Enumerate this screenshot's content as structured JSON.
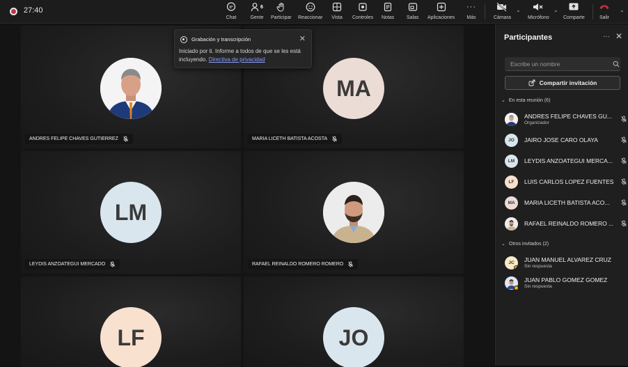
{
  "topbar": {
    "timer": "27:40",
    "people_count": "6",
    "items": [
      {
        "label": "Chat",
        "icon": "chat-icon"
      },
      {
        "label": "Gente",
        "icon": "people-icon"
      },
      {
        "label": "Participar",
        "icon": "raise-hand-icon"
      },
      {
        "label": "Reaccionar",
        "icon": "reaction-icon"
      },
      {
        "label": "Vista",
        "icon": "view-icon"
      },
      {
        "label": "Controles",
        "icon": "controls-icon"
      },
      {
        "label": "Notas",
        "icon": "notes-icon"
      },
      {
        "label": "Salas",
        "icon": "rooms-icon"
      },
      {
        "label": "Aplicaciones",
        "icon": "apps-icon"
      },
      {
        "label": "Más",
        "icon": "more-icon"
      }
    ],
    "camera_label": "Cámara",
    "mic_label": "Micrófono",
    "share_label": "Comparte",
    "leave_label": "Salir",
    "accent_red": "#c4314b"
  },
  "toast": {
    "title": "Grabación y transcripción",
    "body_text": "Iniciado por ti. Informe a todos de que se les está incluyendo.",
    "link_text": "Directiva de privacidad"
  },
  "tiles": [
    {
      "name": "ANDRES FELIPE CHAVES GUTIERREZ",
      "initials": "",
      "photo": true
    },
    {
      "name": "MARIA LICETH BATISTA ACOSTA",
      "initials": "MA",
      "color": "#ecdcd6"
    },
    {
      "name": "LEYDIS ANZOATEGUI MERCADO",
      "initials": "LM",
      "color": "#d9e6ee"
    },
    {
      "name": "RAFAEL REINALDO ROMERO ROMERO",
      "initials": "",
      "photo": true
    },
    {
      "name": "",
      "initials": "LF",
      "color": "#f8e1cf"
    },
    {
      "name": "",
      "initials": "JO",
      "color": "#d9e6ee"
    }
  ],
  "panel": {
    "title": "Participantes",
    "search_placeholder": "Escribe un nombre",
    "share_invite": "Compartir invitación",
    "in_meeting_label": "En esta reunión (6)",
    "others_label": "Otros invitados (2)",
    "in_meeting": [
      {
        "name": "ANDRES FELIPE CHAVES GU...",
        "role": "Organizador",
        "initials": "",
        "photo": true
      },
      {
        "name": "JAIRO JOSE CARO OLAYA",
        "role": "",
        "initials": "JO",
        "color": "#d9e6ee"
      },
      {
        "name": "LEYDIS ANZOATEGUI MERCA...",
        "role": "",
        "initials": "LM",
        "color": "#d9e6ee"
      },
      {
        "name": "LUIS CARLOS LOPEZ FUENTES",
        "role": "",
        "initials": "LF",
        "color": "#f8e1cf"
      },
      {
        "name": "MARIA LICETH BATISTA ACO...",
        "role": "",
        "initials": "MA",
        "color": "#ecdcd6"
      },
      {
        "name": "RAFAEL REINALDO ROMERO ...",
        "role": "",
        "initials": "",
        "photo": true
      }
    ],
    "others": [
      {
        "name": "JUAN MANUEL ALVAREZ CRUZ",
        "role": "Sin respuesta",
        "initials": "JC",
        "color": "#f8e9c8"
      },
      {
        "name": "JUAN PABLO GOMEZ GOMEZ",
        "role": "Sin respuesta",
        "initials": "",
        "photo": true
      }
    ]
  }
}
